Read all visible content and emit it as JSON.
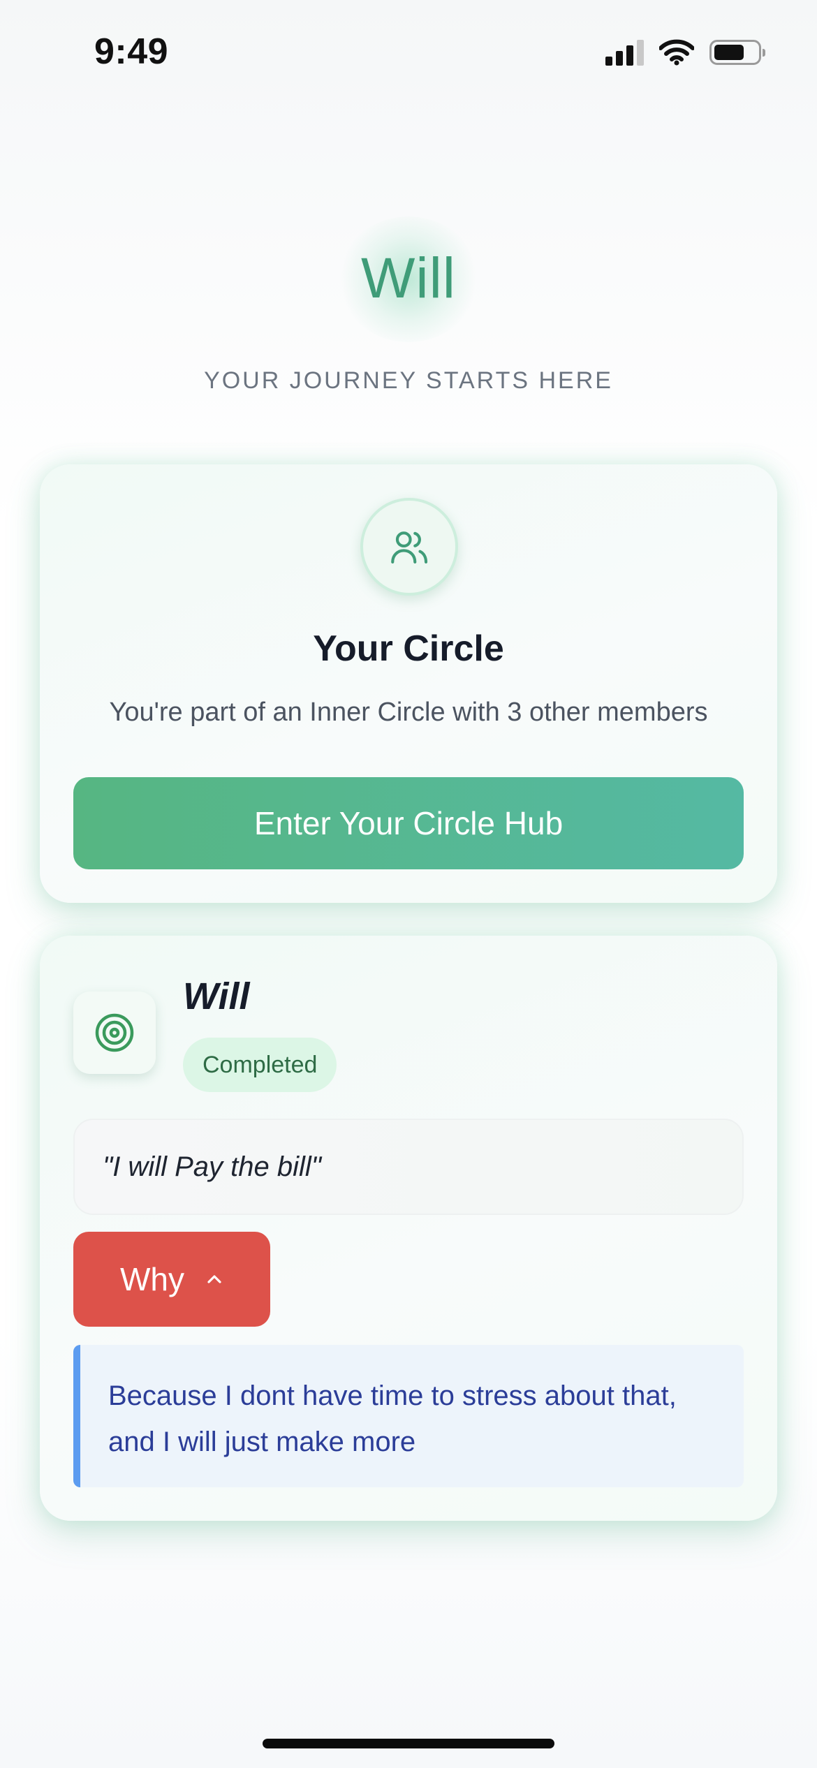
{
  "status_bar": {
    "time": "9:49"
  },
  "header": {
    "title": "Will",
    "subtitle": "YOUR JOURNEY STARTS HERE"
  },
  "circle_card": {
    "icon": "users-icon",
    "title": "Your Circle",
    "description": "You're part of an Inner Circle with 3 other members",
    "button_label": "Enter Your Circle Hub"
  },
  "will_card": {
    "icon": "target-icon",
    "name": "Will",
    "status": "Completed",
    "quote": "\"I will Pay the bill\"",
    "why_label": "Why",
    "why_icon": "chevron-up-icon",
    "reason": "Because I dont have time to stress about that, and I will just make more"
  },
  "colors": {
    "accent_green": "#3f9c78",
    "button_green": "#56b682",
    "why_red": "#dd524a",
    "reason_blue": "#2b3d98",
    "reason_border": "#5c9cf0"
  }
}
